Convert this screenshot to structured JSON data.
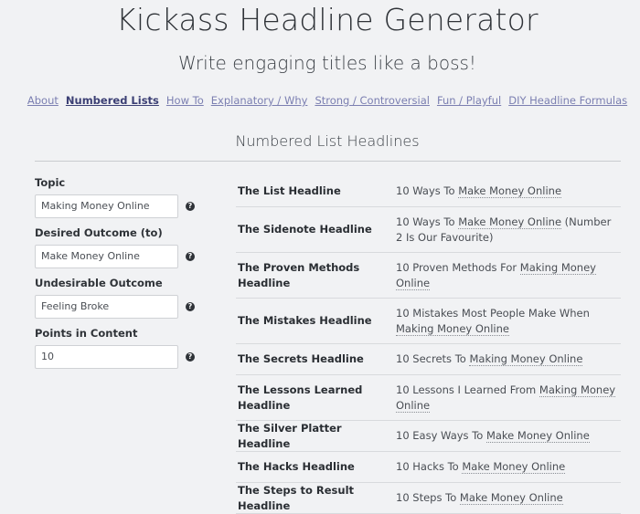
{
  "header": {
    "title": "Kickass Headline Generator",
    "subtitle": "Write engaging titles like a boss!"
  },
  "nav": [
    {
      "label": "About",
      "active": false
    },
    {
      "label": "Numbered Lists",
      "active": true
    },
    {
      "label": "How To",
      "active": false
    },
    {
      "label": "Explanatory / Why",
      "active": false
    },
    {
      "label": "Strong / Controversial",
      "active": false
    },
    {
      "label": "Fun / Playful",
      "active": false
    },
    {
      "label": "DIY Headline Formulas",
      "active": false
    }
  ],
  "section_title": "Numbered List Headlines",
  "form": {
    "fields": [
      {
        "label": "Topic",
        "value": "Making Money Online"
      },
      {
        "label": "Desired Outcome (to)",
        "value": "Make Money Online"
      },
      {
        "label": "Undesirable Outcome",
        "value": "Feeling Broke"
      },
      {
        "label": "Points in Content",
        "value": "10"
      }
    ],
    "help_icon": "?"
  },
  "headlines": [
    {
      "name": "The List Headline",
      "pre": "10 Ways To ",
      "ul": "Make Money Online",
      "post": ""
    },
    {
      "name": "The Sidenote Headline",
      "pre": "10 Ways To ",
      "ul": "Make Money Online",
      "post": " (Number 2 Is Our Favourite)"
    },
    {
      "name": "The Proven Methods Headline",
      "pre": "10 Proven Methods For ",
      "ul": "Making Money Online",
      "post": ""
    },
    {
      "name": "The Mistakes Headline",
      "pre": "10 Mistakes Most People Make When ",
      "ul": "Making Money Online",
      "post": ""
    },
    {
      "name": "The Secrets Headline",
      "pre": "10 Secrets To ",
      "ul": "Making Money Online",
      "post": ""
    },
    {
      "name": "The Lessons Learned Headline",
      "pre": "10 Lessons I Learned From ",
      "ul": "Making Money Online",
      "post": ""
    },
    {
      "name": "The Silver Platter Headline",
      "pre": "10 Easy Ways To ",
      "ul": "Make Money Online",
      "post": ""
    },
    {
      "name": "The Hacks Headline",
      "pre": "10 Hacks To ",
      "ul": "Make Money Online",
      "post": ""
    },
    {
      "name": "The Steps to Result Headline",
      "pre": "10 Steps To ",
      "ul": "Make Money Online",
      "post": ""
    }
  ]
}
